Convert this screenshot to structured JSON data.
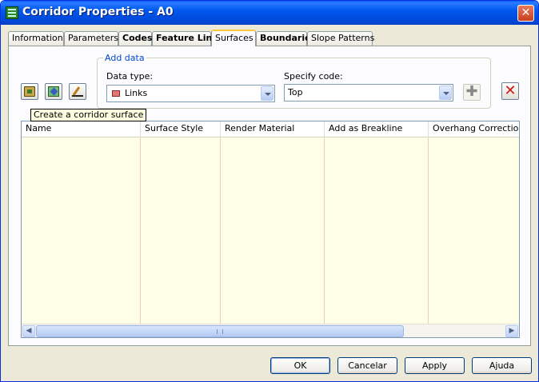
{
  "window": {
    "title": "Corridor Properties - A0",
    "close_label": "✕"
  },
  "tabs": [
    {
      "label": "Information"
    },
    {
      "label": "Parameters"
    },
    {
      "label": "Codes"
    },
    {
      "label": "Feature Lines"
    },
    {
      "label": "Surfaces"
    },
    {
      "label": "Boundaries"
    },
    {
      "label": "Slope Patterns"
    }
  ],
  "add_data": {
    "legend": "Add data",
    "data_type_label": "Data type:",
    "data_type_value": "Links",
    "specify_code_label": "Specify code:",
    "specify_code_value": "Top",
    "add_label": "✚",
    "delete_label": "✕"
  },
  "tooltip": "Create a corridor surface",
  "grid": {
    "columns": [
      "Name",
      "Surface Style",
      "Render Material",
      "Add as Breakline",
      "Overhang Correction"
    ]
  },
  "scrollbar": {
    "left_arrow": "◀",
    "right_arrow": "▶"
  },
  "buttons": {
    "ok": "OK",
    "cancel": "Cancelar",
    "apply": "Apply",
    "help": "Ajuda"
  }
}
